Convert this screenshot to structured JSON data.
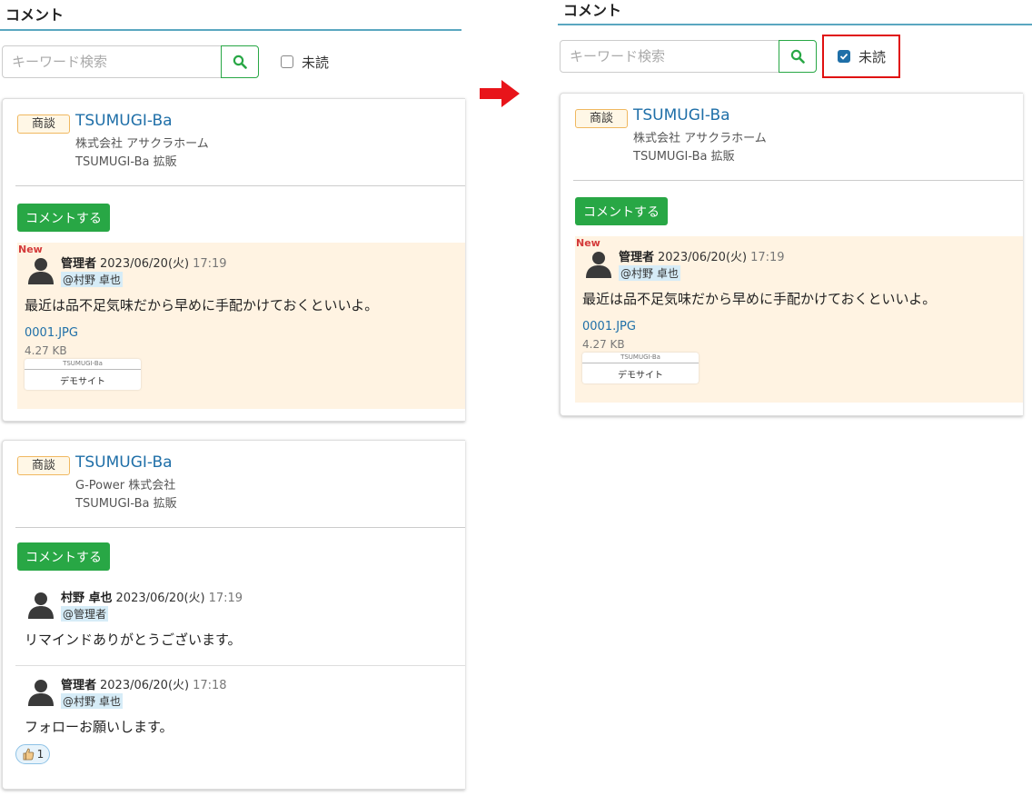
{
  "heading": "コメント",
  "search": {
    "placeholder": "キーワード検索"
  },
  "unread_label": "未読",
  "left": {
    "cards": [
      {
        "tag": "商談",
        "project": "TSUMUGI-Ba",
        "company": "株式会社 アサクラホーム",
        "subtitle": "TSUMUGI-Ba 拡販",
        "comment_button": "コメントする",
        "comments": [
          {
            "new": "New",
            "author": "管理者",
            "date": "2023/06/20(火)",
            "time": "17:19",
            "mention": "@村野 卓也",
            "body": "最近は品不足気味だから早めに手配かけておくといいよ。",
            "file_name": "0001.JPG",
            "file_size": "4.27 KB",
            "thumb_logo": "TSUMUGI-Ba",
            "thumb_text": "デモサイト"
          }
        ]
      },
      {
        "tag": "商談",
        "project": "TSUMUGI-Ba",
        "company": "G-Power 株式会社",
        "subtitle": "TSUMUGI-Ba 拡販",
        "comment_button": "コメントする",
        "comments": [
          {
            "author": "村野 卓也",
            "date": "2023/06/20(火)",
            "time": "17:19",
            "mention": "@管理者",
            "body": "リマインドありがとうございます。"
          },
          {
            "author": "管理者",
            "date": "2023/06/20(火)",
            "time": "17:18",
            "mention": "@村野 卓也",
            "body": "フォローお願いします。",
            "reaction_count": "1"
          }
        ]
      }
    ]
  },
  "right": {
    "unread_checked": true,
    "card": {
      "tag": "商談",
      "project": "TSUMUGI-Ba",
      "company": "株式会社 アサクラホーム",
      "subtitle": "TSUMUGI-Ba 拡販",
      "comment_button": "コメントする",
      "comment": {
        "new": "New",
        "author": "管理者",
        "date": "2023/06/20(火)",
        "time": "17:19",
        "mention": "@村野 卓也",
        "body": "最近は品不足気味だから早めに手配かけておくといいよ。",
        "file_name": "0001.JPG",
        "file_size": "4.27 KB",
        "thumb_logo": "TSUMUGI-Ba",
        "thumb_text": "デモサイト"
      }
    }
  },
  "icons": {
    "search": "search-icon",
    "avatar": "user-avatar-icon",
    "arrow": "arrow-right-icon",
    "reaction": "thumbs-up-icon"
  },
  "colors": {
    "accent_green": "#28a745",
    "link_blue": "#1f6fa8",
    "unread_bg": "#fff3e2",
    "highlight_red": "#e01010"
  }
}
